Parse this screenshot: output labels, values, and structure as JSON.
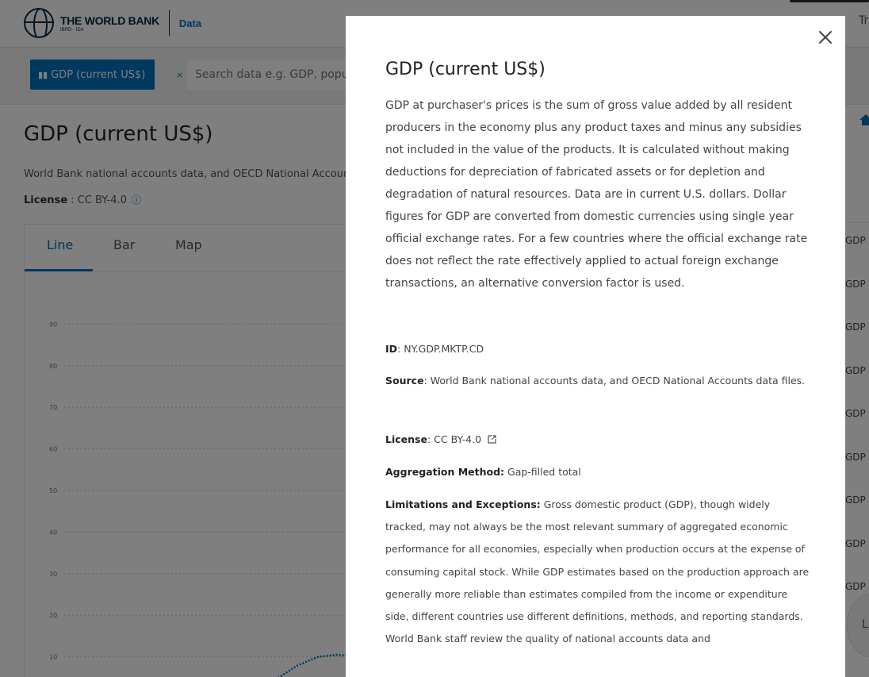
{
  "header": {
    "brand": "THE WORLD BANK",
    "brand_sub": "IBRD · IDA",
    "section": "Data",
    "right_truncated": "Tr"
  },
  "search": {
    "chip_label": "GDP (current US$)",
    "chip_close": "×",
    "placeholder": "Search data e.g. GDP, population, Indonesia"
  },
  "page": {
    "title": "GDP (current US$)",
    "source_text": "World Bank national accounts data, and OECD National Accounts data files.",
    "license_label": "License",
    "license_value": " : CC BY-4.0",
    "info_icon": "ⓘ"
  },
  "tabs": [
    {
      "label": "Line"
    },
    {
      "label": "Bar"
    },
    {
      "label": "Map"
    }
  ],
  "right_list": {
    "items": [
      "GDP",
      "GDP",
      "GDP",
      "GDP",
      "GDP",
      "GDP",
      "GDP",
      "GDP",
      "GDP"
    ],
    "circle_label": "L"
  },
  "chart_data": {
    "type": "line",
    "y_ticks": [
      "10",
      "20",
      "30",
      "40",
      "50",
      "60",
      "70",
      "80",
      "90"
    ],
    "ylim": [
      0,
      100
    ],
    "grid": true,
    "series": [
      {
        "values": [
          2,
          3,
          5,
          8,
          10,
          10.5,
          10
        ]
      }
    ]
  },
  "modal": {
    "close_symbol": "✕",
    "title": "GDP (current US$)",
    "description": "GDP at purchaser's prices is the sum of gross value added by all resident producers in the economy plus any product taxes and minus any subsidies not included in the value of the products. It is calculated without making deductions for depreciation of fabricated assets or for depletion and degradation of natural resources. Data are in current U.S. dollars. Dollar figures for GDP are converted from domestic currencies using single year official exchange rates. For a few countries where the official exchange rate does not reflect the rate effectively applied to actual foreign exchange transactions, an alternative conversion factor is used.",
    "id_label": "ID",
    "id_value": ": NY.GDP.MKTP.CD",
    "source_label": "Source",
    "source_value": ": World Bank national accounts data, and OECD National Accounts data files.",
    "license_label": "License",
    "license_value": ":  CC BY-4.0",
    "aggregation_label": "Aggregation Method:",
    "aggregation_value": " Gap-filled total",
    "limitations_label": "Limitations and Exceptions:",
    "limitations_value": " Gross domestic product (GDP), though widely tracked, may not always be the most relevant summary of aggregated economic performance for all economies, especially when production occurs at the expense of consuming capital stock. While GDP estimates based on the production approach are generally more reliable than estimates compiled from the income or expenditure side, different countries use different definitions, methods, and reporting standards. World Bank staff review the quality of national accounts data and"
  }
}
